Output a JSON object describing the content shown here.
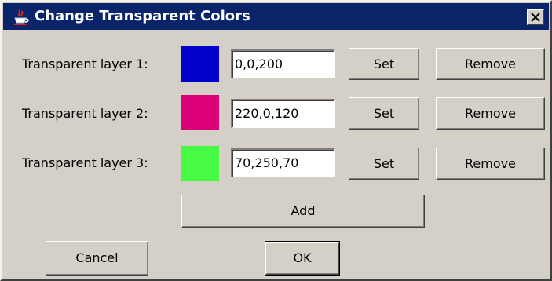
{
  "window": {
    "title": "Change Transparent Colors",
    "app_icon": "java-cup-icon",
    "close_icon": "close-icon"
  },
  "layers": [
    {
      "label": "Transparent layer 1:",
      "color": "#0000c8",
      "value": "0,0,200",
      "set_label": "Set",
      "remove_label": "Remove"
    },
    {
      "label": "Transparent layer 2:",
      "color": "#dc0078",
      "value": "220,0,120",
      "set_label": "Set",
      "remove_label": "Remove"
    },
    {
      "label": "Transparent layer 3:",
      "color": "#46fa46",
      "value": "70,250,70",
      "set_label": "Set",
      "remove_label": "Remove"
    }
  ],
  "actions": {
    "add_label": "Add",
    "cancel_label": "Cancel",
    "ok_label": "OK"
  }
}
